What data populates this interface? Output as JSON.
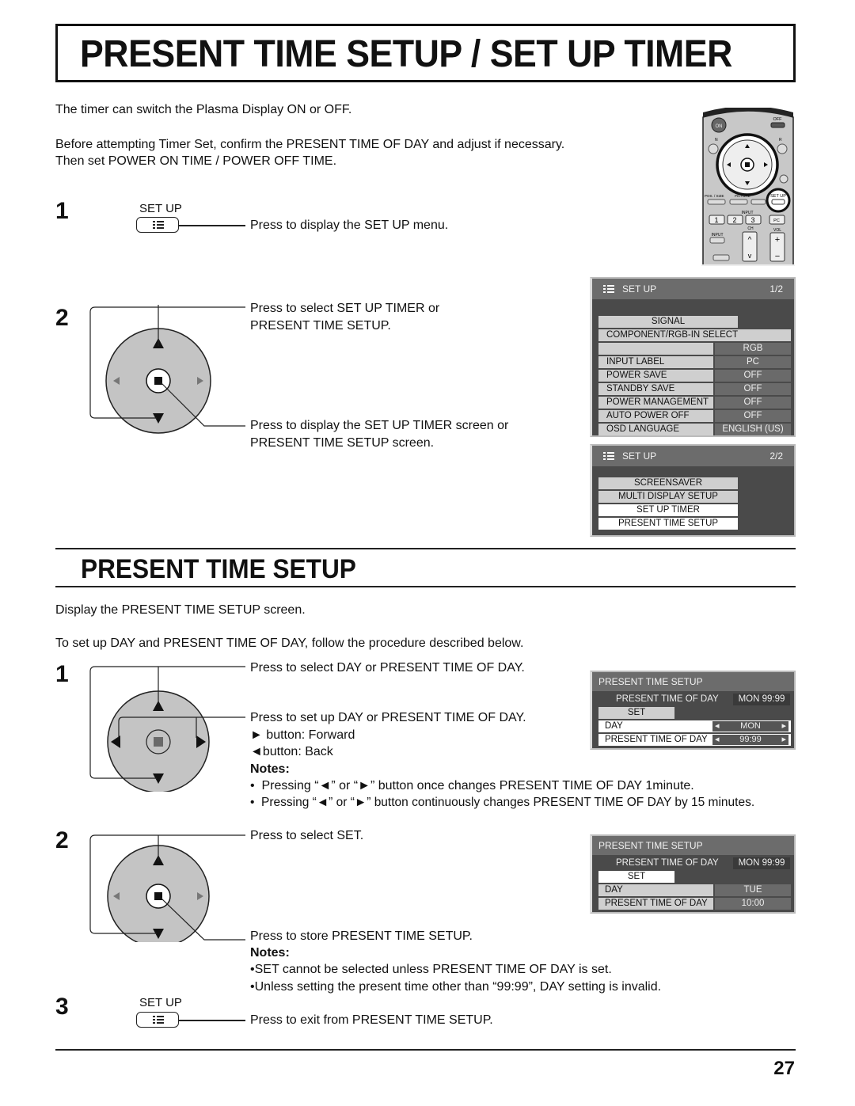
{
  "page": {
    "title": "PRESENT TIME SETUP / SET UP TIMER",
    "page_number": "27"
  },
  "intro": {
    "line1": "The timer can switch the Plasma Display ON or OFF.",
    "line2": "Before attempting Timer Set, confirm the PRESENT TIME OF DAY and adjust if necessary.",
    "line3": "Then set POWER ON TIME / POWER OFF TIME."
  },
  "remote": {
    "on_label": "ON",
    "off_label": "OFF",
    "n_label": "N",
    "r_label": "R",
    "pos_size_label": "POS. / SIZE",
    "picture_label": "PICTURE",
    "sound_label": "SOUND",
    "setup_label": "SET UP",
    "input_group_label": "INPUT",
    "input_keys": [
      "1",
      "2",
      "3",
      "PC"
    ],
    "input_label": "INPUT",
    "ch_label": "CH",
    "vol_label": "VOL"
  },
  "section1": {
    "steps": [
      {
        "number": "1",
        "button_label": "SET UP",
        "desc": "Press to display the SET UP menu."
      },
      {
        "number": "2",
        "desc_a1": "Press to select SET UP TIMER or",
        "desc_a2": "PRESENT TIME SETUP.",
        "desc_b1": "Press to display the SET UP TIMER screen or",
        "desc_b2": "PRESENT TIME SETUP screen."
      }
    ]
  },
  "osd_setup_1": {
    "title": "SET UP",
    "page": "1/2",
    "signal": "SIGNAL",
    "component_select": "COMPONENT/RGB-IN SELECT",
    "component_value": "RGB",
    "rows": [
      {
        "label": "INPUT LABEL",
        "value": "PC"
      },
      {
        "label": "POWER SAVE",
        "value": "OFF"
      },
      {
        "label": "STANDBY SAVE",
        "value": "OFF"
      },
      {
        "label": "POWER MANAGEMENT",
        "value": "OFF"
      },
      {
        "label": "AUTO POWER OFF",
        "value": "OFF"
      },
      {
        "label": "OSD LANGUAGE",
        "value": "ENGLISH (US)"
      }
    ]
  },
  "osd_setup_2": {
    "title": "SET UP",
    "page": "2/2",
    "items": [
      "SCREENSAVER",
      "MULTI DISPLAY SETUP",
      "SET UP TIMER",
      "PRESENT TIME SETUP"
    ]
  },
  "section2": {
    "heading": "PRESENT TIME SETUP",
    "intro1": "Display the PRESENT TIME SETUP screen.",
    "intro2": "To set up DAY and PRESENT TIME OF DAY, follow the procedure described below.",
    "step1": {
      "number": "1",
      "desc_a": "Press to select DAY or PRESENT TIME OF DAY.",
      "desc_b": "Press to set up DAY or PRESENT TIME OF DAY.",
      "forward": "button: Forward",
      "back": "button: Back",
      "notes_label": "Notes:",
      "notes": [
        "Pressing “◄” or “►” button once changes PRESENT TIME OF DAY 1minute.",
        "Pressing “◄” or “►” button continuously changes PRESENT TIME OF DAY by 15 minutes."
      ]
    },
    "step2": {
      "number": "2",
      "desc_a": "Press to select SET.",
      "desc_b": "Press to store PRESENT TIME SETUP.",
      "notes_label": "Notes:",
      "notes": [
        "SET cannot be selected unless PRESENT TIME OF DAY is set.",
        "Unless setting the present time other than “99:99”, DAY setting is invalid."
      ]
    },
    "step3": {
      "number": "3",
      "button_label": "SET UP",
      "desc": "Press to exit from PRESENT TIME SETUP."
    }
  },
  "osd_time_1": {
    "title": "PRESENT  TIME SETUP",
    "current_label": "PRESENT  TIME OF DAY",
    "current_value": "MON  99:99",
    "set_label": "SET",
    "day_label": "DAY",
    "day_value": "MON",
    "time_label": "PRESENT  TIME OF DAY",
    "time_value": "99:99"
  },
  "osd_time_2": {
    "title": "PRESENT  TIME SETUP",
    "current_label": "PRESENT  TIME OF DAY",
    "current_value": "MON  99:99",
    "set_label": "SET",
    "day_label": "DAY",
    "day_value": "TUE",
    "time_label": "PRESENT  TIME OF DAY",
    "time_value": "10:00"
  }
}
